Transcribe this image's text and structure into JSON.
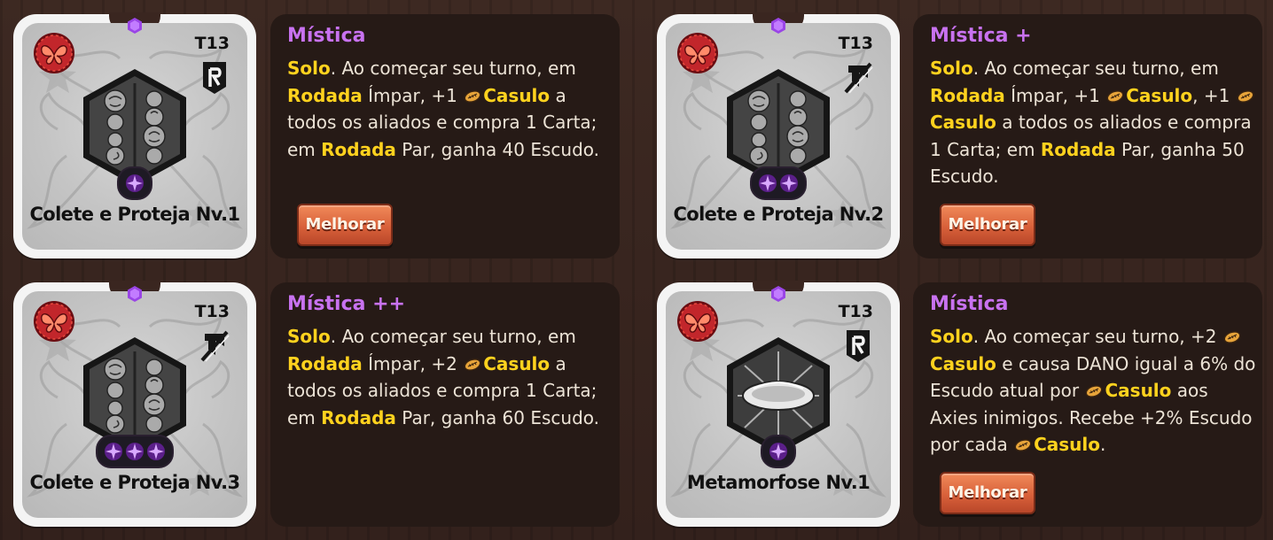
{
  "cards": [
    {
      "tier": "T13",
      "name": "Colete e Proteja Nv.1",
      "level": 1,
      "type_icon": "ranged-icon",
      "art": "cocoon-chain-art",
      "rarity": "Mística",
      "description": [
        {
          "t": "Solo",
          "kw": true
        },
        {
          "t": ". Ao começar seu turno, em "
        },
        {
          "t": "Rodada",
          "kw": true
        },
        {
          "t": " Ímpar, +1 "
        },
        {
          "icon": "cocoon"
        },
        {
          "t": "Casulo",
          "kw": true
        },
        {
          "t": " a todos os aliados e compra 1 Carta; em "
        },
        {
          "t": "Rodada",
          "kw": true
        },
        {
          "t": " Par, ganha 40 Escudo."
        }
      ],
      "upgrade_label": "Melhorar"
    },
    {
      "tier": "T13",
      "name": "Colete e Proteja Nv.2",
      "level": 2,
      "type_icon": "no-attack-icon",
      "art": "cocoon-chain-art",
      "rarity": "Mística +",
      "description": [
        {
          "t": "Solo",
          "kw": true
        },
        {
          "t": ". Ao começar seu turno, em "
        },
        {
          "t": "Rodada",
          "kw": true
        },
        {
          "t": " Ímpar, +1 "
        },
        {
          "icon": "cocoon"
        },
        {
          "t": "Casulo",
          "kw": true
        },
        {
          "t": ", +1 "
        },
        {
          "icon": "cocoon"
        },
        {
          "t": "Casulo",
          "kw": true
        },
        {
          "t": " a todos os aliados e compra 1 Carta; em "
        },
        {
          "t": "Rodada",
          "kw": true
        },
        {
          "t": " Par, ganha 50 Escudo."
        }
      ],
      "upgrade_label": "Melhorar"
    },
    {
      "tier": "T13",
      "name": "Colete e Proteja Nv.3",
      "level": 3,
      "type_icon": "no-attack-icon",
      "art": "cocoon-chain-art",
      "rarity": "Mística ++",
      "description": [
        {
          "t": "Solo",
          "kw": true
        },
        {
          "t": ". Ao começar seu turno, em "
        },
        {
          "t": "Rodada",
          "kw": true
        },
        {
          "t": " Ímpar, +2 "
        },
        {
          "icon": "cocoon"
        },
        {
          "t": "Casulo",
          "kw": true
        },
        {
          "t": " a todos os aliados e compra 1 Carta; em "
        },
        {
          "t": "Rodada",
          "kw": true
        },
        {
          "t": " Par, ganha 60 Escudo."
        }
      ],
      "upgrade_label": ""
    },
    {
      "tier": "T13",
      "name": "Metamorfose Nv.1",
      "level": 1,
      "type_icon": "ranged-icon",
      "art": "metamorphosis-art",
      "rarity": "Mística",
      "description": [
        {
          "t": "Solo",
          "kw": true
        },
        {
          "t": ". Ao começar seu turno, +2 "
        },
        {
          "icon": "cocoon"
        },
        {
          "t": "Casulo",
          "kw": true
        },
        {
          "t": " e causa DANO igual a 6% do Escudo atual por "
        },
        {
          "icon": "cocoon"
        },
        {
          "t": "Casulo",
          "kw": true
        },
        {
          "t": " aos Axies inimigos. Recebe +2% Escudo por cada "
        },
        {
          "icon": "cocoon"
        },
        {
          "t": "Casulo",
          "kw": true
        },
        {
          "t": "."
        }
      ],
      "upgrade_label": "Melhorar"
    }
  ],
  "colors": {
    "rarity": "#c872f0",
    "keyword": "#ffd21e",
    "body_text": "#ece3d6",
    "panel": "#261a16",
    "upgrade_button": "#d9613a"
  }
}
